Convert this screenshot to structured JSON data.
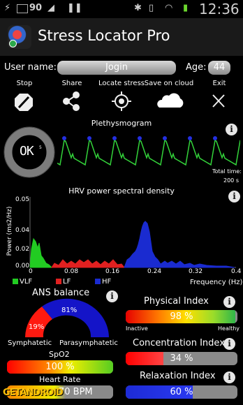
{
  "status_bar": {
    "sim_number": "90",
    "time": "12:36"
  },
  "app": {
    "title": "Stress Locator Pro"
  },
  "user": {
    "name_label": "User name:",
    "name_value": "Jogin",
    "age_label": "Age:",
    "age_value": "44"
  },
  "toolbar": {
    "items": [
      {
        "label": "Stop",
        "icon": "stop-icon"
      },
      {
        "label": "Share",
        "icon": "share-icon"
      },
      {
        "label": "Locate stress",
        "icon": "crosshair-icon"
      },
      {
        "label": "Save on cloud",
        "icon": "cloud-icon"
      },
      {
        "label": "Exit",
        "icon": "close-icon"
      }
    ]
  },
  "pleth": {
    "title": "Plethysmogram",
    "gauge_text": "OK",
    "gauge_sub": "5",
    "total_time_label": "Total time:",
    "total_time_value": "200 s"
  },
  "hrv": {
    "title": "HRV power spectral density",
    "ylabel": "Power (ms2/Hz)",
    "xlabel": "Frequency (Hz)",
    "yticks": [
      "0.05",
      "0.04",
      "0.02",
      "0.00"
    ],
    "xticks": [
      "0",
      "0.08",
      "0.16",
      "0.24",
      "0.32",
      "0.4"
    ],
    "legend": [
      "VLF",
      "LF",
      "HF"
    ],
    "colors": {
      "vlf": "#22cc22",
      "lf": "#e02020",
      "hf": "#1a2bd0"
    }
  },
  "ans": {
    "title": "ANS balance",
    "sympathetic_pct": "19%",
    "parasympathetic_pct": "81%",
    "left_label": "Symphatetic",
    "right_label": "Parasymphatetic"
  },
  "spo2": {
    "label": "SpO2",
    "value": "100 %",
    "level": 1.0
  },
  "heart_rate": {
    "label": "Heart Rate",
    "value": "70 BPM"
  },
  "physical": {
    "title": "Physical Index",
    "value": "98 %",
    "level": 0.98,
    "left": "Inactive",
    "right": "Healthy"
  },
  "concentration": {
    "title": "Concentration Index",
    "value": "34 %",
    "level": 0.34
  },
  "relaxation": {
    "title": "Relaxation Index",
    "value": "60 %",
    "level": 0.6
  },
  "watermark": "GETANDROID"
}
